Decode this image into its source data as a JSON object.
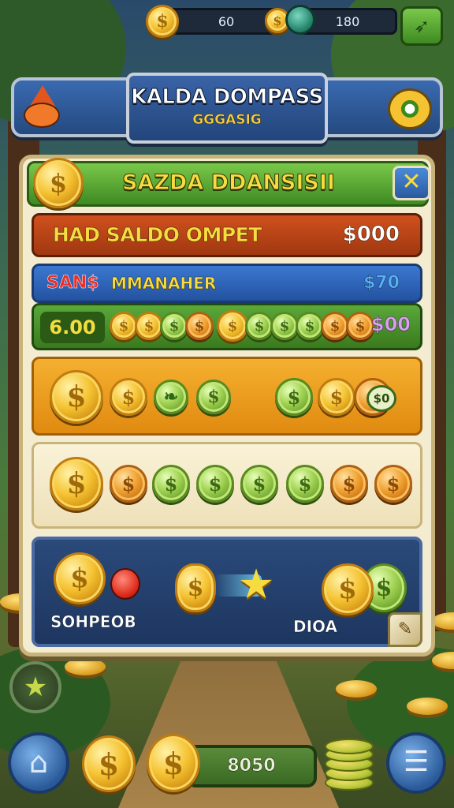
{
  "top_bar": {
    "counter_left_value": "60",
    "counter_right_value": "180",
    "coin_symbol": "$"
  },
  "header": {
    "title": "KALDA DOMPASS",
    "subtitle": "GGGASIG"
  },
  "panel": {
    "title": "SAZDA DDANSISII",
    "close_label": "✕",
    "rows": {
      "red": {
        "label": "HAD SALDO OMPET",
        "value": "$000"
      },
      "blue": {
        "label_red": "SAN$",
        "label_gold": "MMANAHER",
        "value": "$70"
      },
      "green": {
        "label": "6.00",
        "value": "$00"
      },
      "orange": {
        "value": "$0"
      },
      "navy": {
        "label_left": "SOHPEOB",
        "label_right": "DIOA"
      }
    }
  },
  "bottom_bar": {
    "counter_value": "8050"
  },
  "icons": {
    "home": "home-icon",
    "menu": "menu-icon",
    "star": "star-icon",
    "close": "close-icon"
  },
  "colors": {
    "gold": "#f5c332",
    "green_accent": "#3e8a22",
    "blue_accent": "#2452a0",
    "red_accent": "#a03810",
    "orange_accent": "#e08a10"
  }
}
